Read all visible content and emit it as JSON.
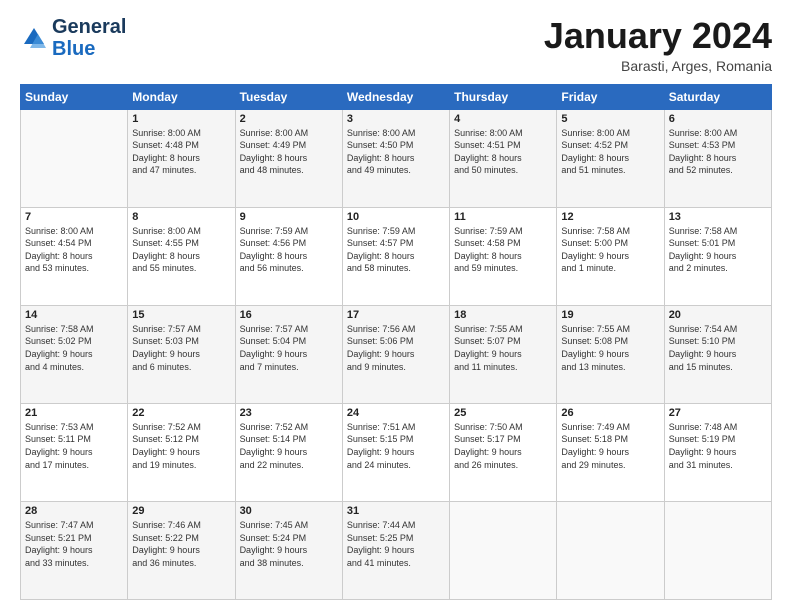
{
  "header": {
    "logo": {
      "general": "General",
      "blue": "Blue"
    },
    "title": "January 2024",
    "location": "Barasti, Arges, Romania"
  },
  "weekdays": [
    "Sunday",
    "Monday",
    "Tuesday",
    "Wednesday",
    "Thursday",
    "Friday",
    "Saturday"
  ],
  "weeks": [
    [
      {
        "day": "",
        "info": ""
      },
      {
        "day": "1",
        "info": "Sunrise: 8:00 AM\nSunset: 4:48 PM\nDaylight: 8 hours\nand 47 minutes."
      },
      {
        "day": "2",
        "info": "Sunrise: 8:00 AM\nSunset: 4:49 PM\nDaylight: 8 hours\nand 48 minutes."
      },
      {
        "day": "3",
        "info": "Sunrise: 8:00 AM\nSunset: 4:50 PM\nDaylight: 8 hours\nand 49 minutes."
      },
      {
        "day": "4",
        "info": "Sunrise: 8:00 AM\nSunset: 4:51 PM\nDaylight: 8 hours\nand 50 minutes."
      },
      {
        "day": "5",
        "info": "Sunrise: 8:00 AM\nSunset: 4:52 PM\nDaylight: 8 hours\nand 51 minutes."
      },
      {
        "day": "6",
        "info": "Sunrise: 8:00 AM\nSunset: 4:53 PM\nDaylight: 8 hours\nand 52 minutes."
      }
    ],
    [
      {
        "day": "7",
        "info": "Sunrise: 8:00 AM\nSunset: 4:54 PM\nDaylight: 8 hours\nand 53 minutes."
      },
      {
        "day": "8",
        "info": "Sunrise: 8:00 AM\nSunset: 4:55 PM\nDaylight: 8 hours\nand 55 minutes."
      },
      {
        "day": "9",
        "info": "Sunrise: 7:59 AM\nSunset: 4:56 PM\nDaylight: 8 hours\nand 56 minutes."
      },
      {
        "day": "10",
        "info": "Sunrise: 7:59 AM\nSunset: 4:57 PM\nDaylight: 8 hours\nand 58 minutes."
      },
      {
        "day": "11",
        "info": "Sunrise: 7:59 AM\nSunset: 4:58 PM\nDaylight: 8 hours\nand 59 minutes."
      },
      {
        "day": "12",
        "info": "Sunrise: 7:58 AM\nSunset: 5:00 PM\nDaylight: 9 hours\nand 1 minute."
      },
      {
        "day": "13",
        "info": "Sunrise: 7:58 AM\nSunset: 5:01 PM\nDaylight: 9 hours\nand 2 minutes."
      }
    ],
    [
      {
        "day": "14",
        "info": "Sunrise: 7:58 AM\nSunset: 5:02 PM\nDaylight: 9 hours\nand 4 minutes."
      },
      {
        "day": "15",
        "info": "Sunrise: 7:57 AM\nSunset: 5:03 PM\nDaylight: 9 hours\nand 6 minutes."
      },
      {
        "day": "16",
        "info": "Sunrise: 7:57 AM\nSunset: 5:04 PM\nDaylight: 9 hours\nand 7 minutes."
      },
      {
        "day": "17",
        "info": "Sunrise: 7:56 AM\nSunset: 5:06 PM\nDaylight: 9 hours\nand 9 minutes."
      },
      {
        "day": "18",
        "info": "Sunrise: 7:55 AM\nSunset: 5:07 PM\nDaylight: 9 hours\nand 11 minutes."
      },
      {
        "day": "19",
        "info": "Sunrise: 7:55 AM\nSunset: 5:08 PM\nDaylight: 9 hours\nand 13 minutes."
      },
      {
        "day": "20",
        "info": "Sunrise: 7:54 AM\nSunset: 5:10 PM\nDaylight: 9 hours\nand 15 minutes."
      }
    ],
    [
      {
        "day": "21",
        "info": "Sunrise: 7:53 AM\nSunset: 5:11 PM\nDaylight: 9 hours\nand 17 minutes."
      },
      {
        "day": "22",
        "info": "Sunrise: 7:52 AM\nSunset: 5:12 PM\nDaylight: 9 hours\nand 19 minutes."
      },
      {
        "day": "23",
        "info": "Sunrise: 7:52 AM\nSunset: 5:14 PM\nDaylight: 9 hours\nand 22 minutes."
      },
      {
        "day": "24",
        "info": "Sunrise: 7:51 AM\nSunset: 5:15 PM\nDaylight: 9 hours\nand 24 minutes."
      },
      {
        "day": "25",
        "info": "Sunrise: 7:50 AM\nSunset: 5:17 PM\nDaylight: 9 hours\nand 26 minutes."
      },
      {
        "day": "26",
        "info": "Sunrise: 7:49 AM\nSunset: 5:18 PM\nDaylight: 9 hours\nand 29 minutes."
      },
      {
        "day": "27",
        "info": "Sunrise: 7:48 AM\nSunset: 5:19 PM\nDaylight: 9 hours\nand 31 minutes."
      }
    ],
    [
      {
        "day": "28",
        "info": "Sunrise: 7:47 AM\nSunset: 5:21 PM\nDaylight: 9 hours\nand 33 minutes."
      },
      {
        "day": "29",
        "info": "Sunrise: 7:46 AM\nSunset: 5:22 PM\nDaylight: 9 hours\nand 36 minutes."
      },
      {
        "day": "30",
        "info": "Sunrise: 7:45 AM\nSunset: 5:24 PM\nDaylight: 9 hours\nand 38 minutes."
      },
      {
        "day": "31",
        "info": "Sunrise: 7:44 AM\nSunset: 5:25 PM\nDaylight: 9 hours\nand 41 minutes."
      },
      {
        "day": "",
        "info": ""
      },
      {
        "day": "",
        "info": ""
      },
      {
        "day": "",
        "info": ""
      }
    ]
  ]
}
